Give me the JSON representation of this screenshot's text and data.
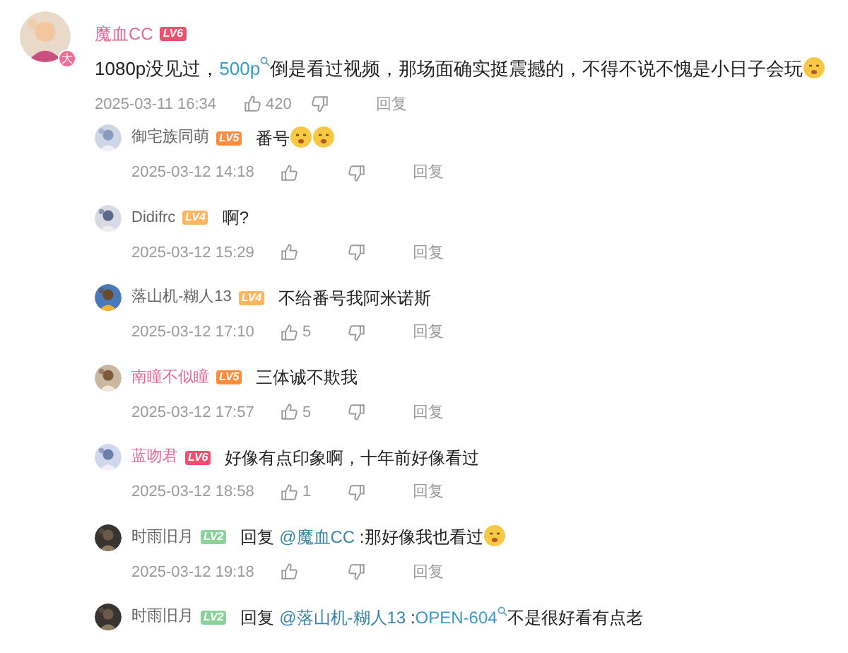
{
  "comment": {
    "user": {
      "name": "魔血CC",
      "vip": true,
      "level": "LV6",
      "color": "#f0506e",
      "avatar_badge": "大"
    },
    "content": [
      {
        "kind": "text",
        "text": "1080p没见过，"
      },
      {
        "kind": "keyword",
        "text": "500p"
      },
      {
        "kind": "text",
        "text": "倒是看过视频，那场面确实挺震撼的，不得不说不愧是小日子会玩"
      },
      {
        "kind": "emoji"
      }
    ],
    "time": "2025-03-11 16:34",
    "likes": "420",
    "reply_label": "回复"
  },
  "replies": [
    {
      "user": {
        "name": "御宅族同萌",
        "vip": false,
        "level": "LV5",
        "color": "#ff8c3b"
      },
      "content": [
        {
          "kind": "text",
          "text": "番号"
        },
        {
          "kind": "emoji"
        },
        {
          "kind": "emoji"
        }
      ],
      "time": "2025-03-12 14:18",
      "reply_label": "回复"
    },
    {
      "user": {
        "name": "Didifrc",
        "vip": false,
        "level": "LV4",
        "color": "#ffb45e"
      },
      "content": [
        {
          "kind": "text",
          "text": "啊?"
        }
      ],
      "time": "2025-03-12 15:29",
      "reply_label": "回复"
    },
    {
      "user": {
        "name": "落山机-糊人13",
        "vip": false,
        "level": "LV4",
        "color": "#ffb45e"
      },
      "content": [
        {
          "kind": "text",
          "text": "不给番号我阿米诺斯"
        }
      ],
      "time": "2025-03-12 17:10",
      "likes": "5",
      "reply_label": "回复"
    },
    {
      "user": {
        "name": "南瞳不似瞳",
        "vip": true,
        "level": "LV5",
        "color": "#ff8c3b"
      },
      "content": [
        {
          "kind": "text",
          "text": "三体诚不欺我"
        }
      ],
      "time": "2025-03-12 17:57",
      "likes": "5",
      "reply_label": "回复"
    },
    {
      "user": {
        "name": "蓝吻君",
        "vip": true,
        "level": "LV6",
        "color": "#f0506e"
      },
      "content": [
        {
          "kind": "text",
          "text": "好像有点印象啊，十年前好像看过"
        }
      ],
      "time": "2025-03-12 18:58",
      "likes": "1",
      "reply_label": "回复"
    },
    {
      "user": {
        "name": "时雨旧月",
        "vip": false,
        "level": "LV2",
        "color": "#8bd29b"
      },
      "content": [
        {
          "kind": "text",
          "text": "回复 "
        },
        {
          "kind": "mention",
          "text": "@魔血CC"
        },
        {
          "kind": "text",
          "text": " :那好像我也看过"
        },
        {
          "kind": "emoji"
        }
      ],
      "time": "2025-03-12 19:18",
      "reply_label": "回复"
    },
    {
      "user": {
        "name": "时雨旧月",
        "vip": false,
        "level": "LV2",
        "color": "#8bd29b"
      },
      "content": [
        {
          "kind": "text",
          "text": "回复 "
        },
        {
          "kind": "mention",
          "text": "@落山机-糊人13"
        },
        {
          "kind": "text",
          "text": " :"
        },
        {
          "kind": "keyword",
          "text": "OPEN-604"
        },
        {
          "kind": "text",
          "text": "不是很好看有点老"
        }
      ]
    }
  ]
}
